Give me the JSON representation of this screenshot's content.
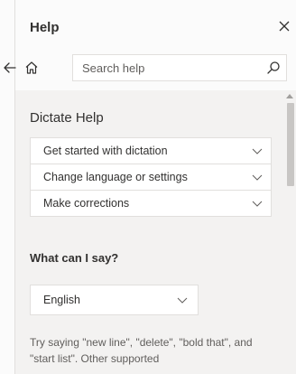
{
  "header": {
    "title": "Help"
  },
  "nav": {
    "search": {
      "placeholder": "Search help",
      "value": ""
    }
  },
  "content": {
    "section_title": "Dictate Help",
    "accordion": [
      {
        "label": "Get started with dictation"
      },
      {
        "label": "Change language or settings"
      },
      {
        "label": "Make corrections"
      }
    ],
    "subheading": "What can I say?",
    "language_select": {
      "selected": "English"
    },
    "paragraph": "Try saying \"new line\", \"delete\", \"bold that\", and \"start list\". Other supported"
  },
  "icons": {
    "close": "close-icon",
    "back": "arrow-left-icon",
    "home": "home-icon",
    "search": "search-icon",
    "chevron": "chevron-down-icon"
  },
  "colors": {
    "pane_bg": "#fbfbfb",
    "content_bg": "#f3f2f1",
    "border": "#e1dfdd",
    "text": "#323130",
    "muted_text": "#605e5c",
    "scroll_thumb": "#c8c6c4"
  }
}
